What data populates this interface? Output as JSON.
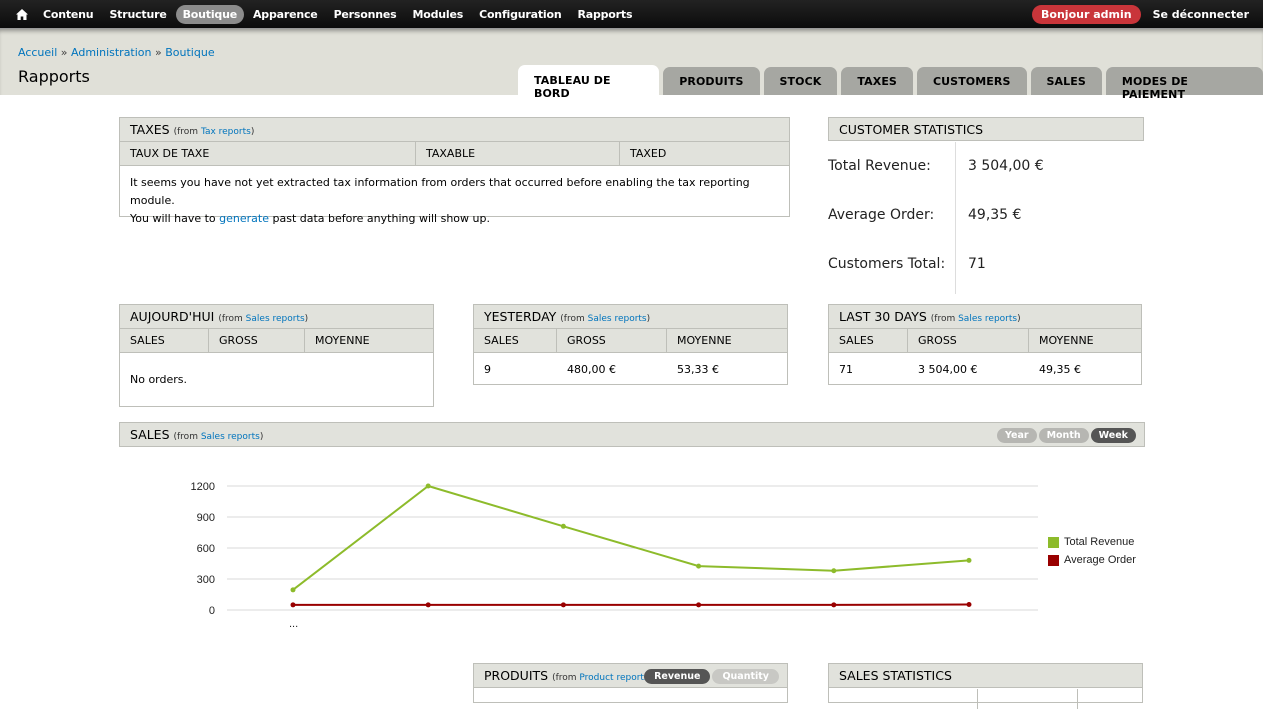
{
  "toolbar": {
    "home_icon": "home-icon",
    "items": [
      {
        "label": "Contenu",
        "active": false
      },
      {
        "label": "Structure",
        "active": false
      },
      {
        "label": "Boutique",
        "active": true
      },
      {
        "label": "Apparence",
        "active": false
      },
      {
        "label": "Personnes",
        "active": false
      },
      {
        "label": "Modules",
        "active": false
      },
      {
        "label": "Configuration",
        "active": false
      },
      {
        "label": "Rapports",
        "active": false
      }
    ],
    "greeting": "Bonjour admin",
    "logout": "Se déconnecter"
  },
  "header": {
    "breadcrumb": [
      "Accueil",
      "Administration",
      "Boutique"
    ],
    "breadcrumb_sep": "»",
    "title": "Rapports",
    "tabs": [
      {
        "label": "TABLEAU DE BORD",
        "active": true
      },
      {
        "label": "PRODUITS",
        "active": false
      },
      {
        "label": "STOCK",
        "active": false
      },
      {
        "label": "TAXES",
        "active": false
      },
      {
        "label": "CUSTOMERS",
        "active": false
      },
      {
        "label": "SALES",
        "active": false
      },
      {
        "label": "MODES DE PAIEMENT",
        "active": false
      }
    ]
  },
  "taxes": {
    "title": "TAXES",
    "from_prefix": "(from ",
    "from_link": "Tax reports",
    "from_suffix": ")",
    "columns": [
      "TAUX DE TAXE",
      "TAXABLE",
      "TAXED"
    ],
    "message_line1": "It seems you have not yet extracted tax information from orders that occurred before enabling the tax reporting module.",
    "message_line2_pre": "You will have to ",
    "message_link": "generate",
    "message_line2_post": " past data before anything will show up."
  },
  "customer_stats": {
    "title": "CUSTOMER STATISTICS",
    "rows": [
      {
        "label": "Total Revenue:",
        "value": "3 504,00 €"
      },
      {
        "label": "Average Order:",
        "value": "49,35 €"
      },
      {
        "label": "Customers Total:",
        "value": "71"
      }
    ]
  },
  "today": {
    "title": "AUJOURD'HUI",
    "from_link": "Sales reports",
    "columns": [
      "SALES",
      "GROSS",
      "MOYENNE"
    ],
    "message": "No orders."
  },
  "yesterday": {
    "title": "YESTERDAY",
    "from_link": "Sales reports",
    "columns": [
      "SALES",
      "GROSS",
      "MOYENNE"
    ],
    "row": [
      "9",
      "480,00 €",
      "53,33 €"
    ]
  },
  "last30": {
    "title": "LAST 30 DAYS",
    "from_link": "Sales reports",
    "columns": [
      "SALES",
      "GROSS",
      "MOYENNE"
    ],
    "row": [
      "71",
      "3 504,00 €",
      "49,35 €"
    ]
  },
  "sales": {
    "title": "SALES",
    "from_link": "Sales reports",
    "periods": [
      {
        "label": "Year",
        "active": false
      },
      {
        "label": "Month",
        "active": false
      },
      {
        "label": "Week",
        "active": true
      }
    ]
  },
  "produits": {
    "title": "PRODUITS",
    "from_link": "Product reports",
    "toggles": [
      {
        "label": "Revenue",
        "active": true
      },
      {
        "label": "Quantity",
        "active": false
      }
    ]
  },
  "sales_stats": {
    "title": "SALES STATISTICS"
  },
  "common": {
    "from_prefix": "(from ",
    "from_suffix": ")"
  },
  "chart_data": {
    "type": "line",
    "title": "",
    "xlabel": "",
    "ylabel": "",
    "x": [
      "...",
      "",
      "",
      "",
      "",
      ""
    ],
    "ylim": [
      0,
      1200
    ],
    "yticks": [
      0,
      300,
      600,
      900,
      1200
    ],
    "grid": true,
    "legend_position": "right",
    "series": [
      {
        "name": "Total Revenue",
        "color": "#8dbb2b",
        "values": [
          195,
          1200,
          810,
          425,
          380,
          480
        ]
      },
      {
        "name": "Average Order",
        "color": "#990000",
        "values": [
          50,
          50,
          50,
          50,
          50,
          53
        ]
      }
    ]
  }
}
